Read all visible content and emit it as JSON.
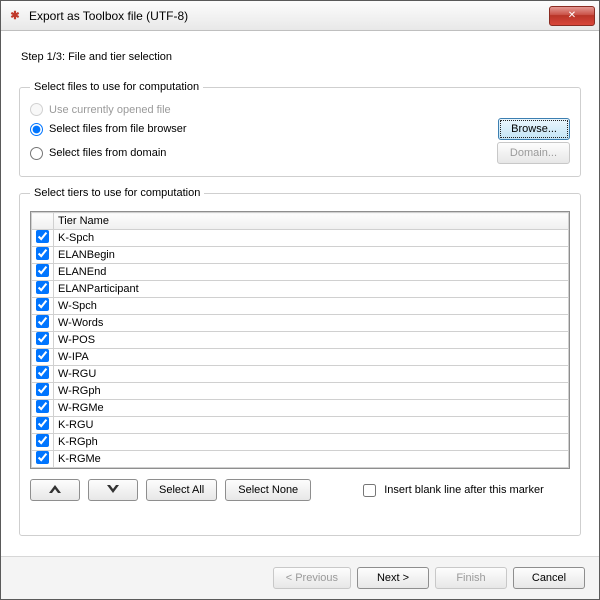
{
  "window": {
    "title": "Export as Toolbox file (UTF-8)"
  },
  "step": "Step 1/3: File and tier selection",
  "files": {
    "legend": "Select files to use for computation",
    "opt_current": "Use currently opened file",
    "opt_browser": "Select files from file browser",
    "opt_domain": "Select files from domain",
    "browse_btn": "Browse...",
    "domain_btn": "Domain...",
    "selected": "browser",
    "current_disabled": true
  },
  "tiers": {
    "legend": "Select tiers to use for computation",
    "col_check": "",
    "col_name": "Tier Name",
    "rows": [
      {
        "checked": true,
        "name": "K-Spch"
      },
      {
        "checked": true,
        "name": "ELANBegin"
      },
      {
        "checked": true,
        "name": "ELANEnd"
      },
      {
        "checked": true,
        "name": "ELANParticipant"
      },
      {
        "checked": true,
        "name": "W-Spch"
      },
      {
        "checked": true,
        "name": "W-Words"
      },
      {
        "checked": true,
        "name": "W-POS"
      },
      {
        "checked": true,
        "name": "W-IPA"
      },
      {
        "checked": true,
        "name": "W-RGU"
      },
      {
        "checked": true,
        "name": "W-RGph"
      },
      {
        "checked": true,
        "name": "W-RGMe"
      },
      {
        "checked": true,
        "name": "K-RGU"
      },
      {
        "checked": true,
        "name": "K-RGph"
      },
      {
        "checked": true,
        "name": "K-RGMe"
      }
    ],
    "move_up": "▲",
    "move_down": "▼",
    "select_all": "Select All",
    "select_none": "Select None",
    "insert_blank": "Insert blank line after this marker",
    "insert_blank_checked": false
  },
  "footer": {
    "previous": "< Previous",
    "next": "Next >",
    "finish": "Finish",
    "cancel": "Cancel"
  },
  "icons": {
    "app": "✱",
    "close": "✕"
  }
}
